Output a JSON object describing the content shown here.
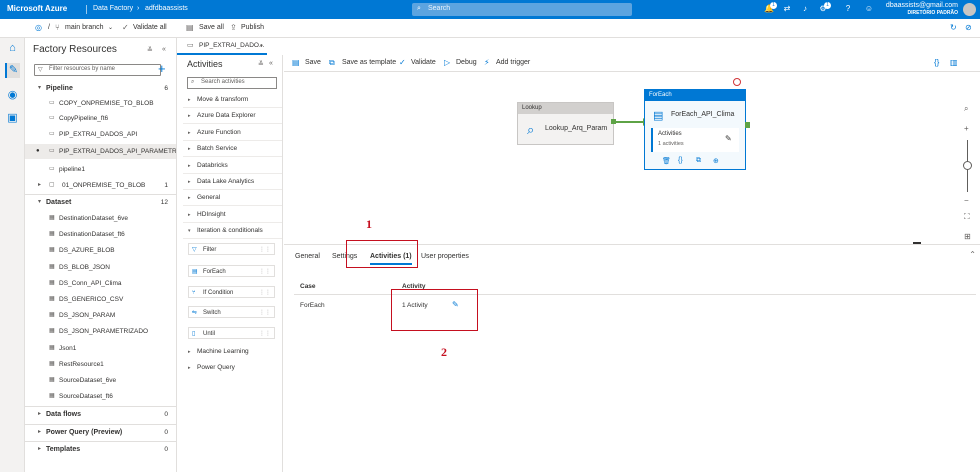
{
  "topbar": {
    "brand": "Microsoft Azure",
    "crumbs": [
      "Data Factory",
      "adfdbaassists"
    ],
    "search_placeholder": "Search",
    "notif_count": "1",
    "settings_count": "1",
    "user_email": "dbaassists@gmail.com",
    "user_dir": "DIRETÓRIO PADRÃO"
  },
  "toolbar2": {
    "branch": "main branch",
    "validate_all": "Validate all",
    "save_all": "Save all",
    "publish": "Publish",
    "publish_count": "1"
  },
  "factory": {
    "title": "Factory Resources",
    "filter_placeholder": "Filter resources by name",
    "pipeline_label": "Pipeline",
    "pipeline_count": "6",
    "pipelines": [
      "COPY_ONPREMISE_TO_BLOB",
      "CopyPipeline_ft6",
      "PIP_EXTRAI_DADOS_API",
      "PIP_EXTRAI_DADOS_API_PARAMETRI...",
      "pipeline1"
    ],
    "folder": {
      "label": "01_ONPREMISE_TO_BLOB",
      "count": "1"
    },
    "dataset_label": "Dataset",
    "dataset_count": "12",
    "datasets": [
      "DestinationDataset_6ve",
      "DestinationDataset_ft6",
      "DS_AZURE_BLOB",
      "DS_BLOB_JSON",
      "DS_Conn_API_Clima",
      "DS_GENERICO_CSV",
      "DS_JSON_PARAM",
      "DS_JSON_PARAMETRIZADO",
      "Json1",
      "RestResource1",
      "SourceDataset_6ve",
      "SourceDataset_ft6"
    ],
    "sections": [
      {
        "label": "Data flows",
        "count": "0"
      },
      {
        "label": "Power Query (Preview)",
        "count": "0"
      },
      {
        "label": "Templates",
        "count": "0"
      }
    ]
  },
  "pipeline_tab": "PIP_EXTRAI_DADO...",
  "activities": {
    "title": "Activities",
    "search_placeholder": "Search activities",
    "categories_top": [
      "Move & transform",
      "Azure Data Explorer",
      "Azure Function",
      "Batch Service",
      "Databricks",
      "Data Lake Analytics",
      "General",
      "HDInsight"
    ],
    "iteration_label": "Iteration & conditionals",
    "iteration_items": [
      "Filter",
      "ForEach",
      "If Condition",
      "Switch",
      "Until"
    ],
    "categories_bottom": [
      "Machine Learning",
      "Power Query"
    ]
  },
  "cmdbar": {
    "save": "Save",
    "save_as_template": "Save as template",
    "validate": "Validate",
    "debug": "Debug",
    "add_trigger": "Add trigger"
  },
  "canvas": {
    "lookup_header": "Lookup",
    "lookup_name": "Lookup_Arq_Param",
    "foreach_header": "ForEach",
    "foreach_name": "ForEach_API_Clima",
    "inner_title": "Activities",
    "inner_count": "1 activities"
  },
  "bottom": {
    "tabs": [
      "General",
      "Settings",
      "Activities (1)",
      "User properties"
    ],
    "col_case": "Case",
    "col_activity": "Activity",
    "row_case": "ForEach",
    "row_activity": "1 Activity"
  },
  "annotations": {
    "n1": "1",
    "n2": "2",
    "color": "#c50f1f"
  },
  "colors": {
    "brand": "#0078d4",
    "success": "#5ea346"
  }
}
